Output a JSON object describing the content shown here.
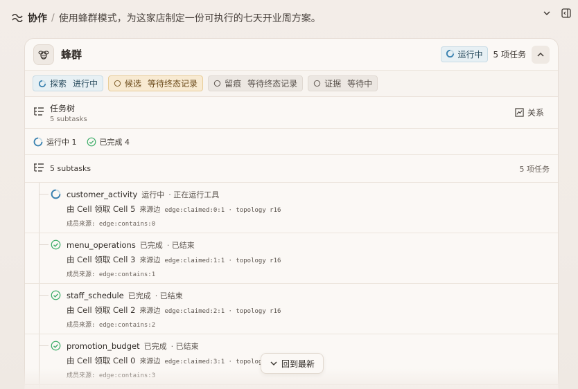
{
  "topbar": {
    "crumb": "协作",
    "separator": "/",
    "task": "使用蜂群模式，为这家店制定一份可执行的七天开业周方案。"
  },
  "panel": {
    "title": "蜂群",
    "running_label": "运行中",
    "task_count": "5 项任务"
  },
  "phases": [
    {
      "name": "探索",
      "status": "进行中"
    },
    {
      "name": "候选",
      "status": "等待终态记录"
    },
    {
      "name": "留痕",
      "status": "等待终态记录"
    },
    {
      "name": "证据",
      "status": "等待中"
    }
  ],
  "tree": {
    "title": "任务树",
    "subtitle": "5 subtasks",
    "relation_label": "关系"
  },
  "summary": {
    "running": "运行中 1",
    "done": "已完成 4"
  },
  "subtasks_header": {
    "label": "5 subtasks",
    "count": "5 项任务"
  },
  "rows": [
    {
      "name": "customer_activity",
      "state": "运行中",
      "detail": "· 正在运行工具",
      "claim": "由 Cell 领取 Cell 5",
      "src_label": "来源边",
      "src": "edge:claimed:0:1 · topology r16",
      "member": "成员来源: edge:contains:0",
      "status": "running"
    },
    {
      "name": "menu_operations",
      "state": "已完成",
      "detail": "· 已结束",
      "claim": "由 Cell 领取 Cell 3",
      "src_label": "来源边",
      "src": "edge:claimed:1:1 · topology r16",
      "member": "成员来源: edge:contains:1",
      "status": "done"
    },
    {
      "name": "staff_schedule",
      "state": "已完成",
      "detail": "· 已结束",
      "claim": "由 Cell 领取 Cell 2",
      "src_label": "来源边",
      "src": "edge:claimed:2:1 · topology r16",
      "member": "成员来源: edge:contains:2",
      "status": "done"
    },
    {
      "name": "promotion_budget",
      "state": "已完成",
      "detail": "· 已结束",
      "claim": "由 Cell 领取 Cell 0",
      "src_label": "来源边",
      "src": "edge:claimed:3:1 · topology r16",
      "member": "成员来源: edge:contains:3",
      "status": "done"
    }
  ],
  "back_latest": "回到最新",
  "colors": {
    "accent_running": "#3b82b0",
    "accent_done": "#3fae6a",
    "candidate": "#c98a2a"
  }
}
